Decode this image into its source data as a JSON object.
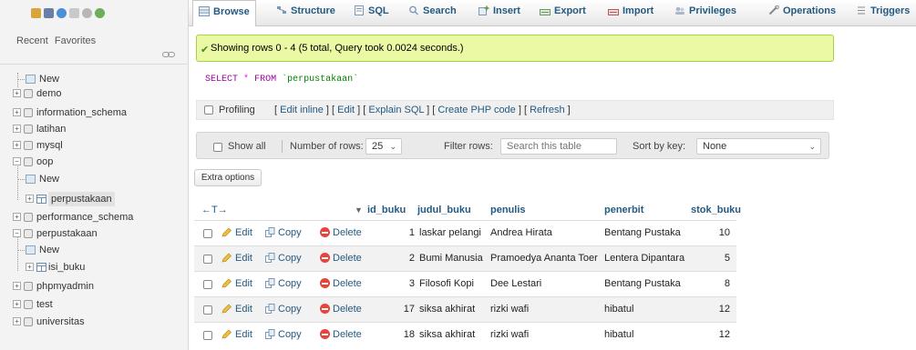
{
  "sidebar": {
    "tabs": [
      "Recent",
      "Favorites"
    ],
    "tree": [
      {
        "label": "New",
        "kind": "new"
      },
      {
        "label": "demo",
        "kind": "db"
      },
      {
        "label": "information_schema",
        "kind": "db"
      },
      {
        "label": "latihan",
        "kind": "db"
      },
      {
        "label": "mysql",
        "kind": "db"
      },
      {
        "label": "oop",
        "kind": "db-open"
      },
      {
        "label": "New",
        "kind": "new-child"
      },
      {
        "label": "perpustakaan",
        "kind": "table-selected"
      },
      {
        "label": "performance_schema",
        "kind": "db"
      },
      {
        "label": "perpustakaan",
        "kind": "db-open"
      },
      {
        "label": "New",
        "kind": "new-child"
      },
      {
        "label": "isi_buku",
        "kind": "table"
      },
      {
        "label": "phpmyadmin",
        "kind": "db"
      },
      {
        "label": "test",
        "kind": "db"
      },
      {
        "label": "universitas",
        "kind": "db"
      }
    ]
  },
  "tabs": [
    {
      "label": "Browse",
      "icon": "browse-icon",
      "active": true
    },
    {
      "label": "Structure",
      "icon": "structure-icon"
    },
    {
      "label": "SQL",
      "icon": "sql-icon"
    },
    {
      "label": "Search",
      "icon": "search-icon"
    },
    {
      "label": "Insert",
      "icon": "insert-icon"
    },
    {
      "label": "Export",
      "icon": "export-icon"
    },
    {
      "label": "Import",
      "icon": "import-icon"
    },
    {
      "label": "Privileges",
      "icon": "privileges-icon"
    },
    {
      "label": "Operations",
      "icon": "operations-icon"
    },
    {
      "label": "Triggers",
      "icon": "triggers-icon"
    }
  ],
  "success": {
    "message": "Showing rows 0 - 4 (5 total, Query took 0.0024 seconds.)"
  },
  "query": {
    "keyword1": "SELECT",
    "star": "*",
    "keyword2": "FROM",
    "table": "`perpustakaan`"
  },
  "profiling": {
    "label": "Profiling",
    "links": [
      "Edit inline",
      "Edit",
      "Explain SQL",
      "Create PHP code",
      "Refresh"
    ]
  },
  "nav": {
    "show_all": "Show all",
    "rows_label": "Number of rows:",
    "rows_value": "25",
    "filter_label": "Filter rows:",
    "filter_placeholder": "Search this table",
    "sort_label": "Sort by key:",
    "sort_value": "None"
  },
  "extra_options": "Extra options",
  "table": {
    "arrows": "←T→",
    "sort_marker": "▼",
    "columns": [
      "id_buku",
      "judul_buku",
      "penulis",
      "penerbit",
      "stok_buku"
    ],
    "actions": {
      "edit": "Edit",
      "copy": "Copy",
      "delete": "Delete"
    },
    "rows": [
      {
        "id_buku": "1",
        "judul_buku": "laskar pelangi",
        "penulis": "Andrea Hirata",
        "penerbit": "Bentang Pustaka",
        "stok_buku": "10"
      },
      {
        "id_buku": "2",
        "judul_buku": "Bumi Manusia",
        "penulis": "Pramoedya Ananta Toer",
        "penerbit": "Lentera Dipantara",
        "stok_buku": "5"
      },
      {
        "id_buku": "3",
        "judul_buku": "Filosofi Kopi",
        "penulis": "Dee Lestari",
        "penerbit": "Bentang Pustaka",
        "stok_buku": "8"
      },
      {
        "id_buku": "17",
        "judul_buku": "siksa akhirat",
        "penulis": "rizki wafi",
        "penerbit": "hibatul",
        "stok_buku": "12"
      },
      {
        "id_buku": "18",
        "judul_buku": "siksa akhirat",
        "penulis": "rizki wafi",
        "penerbit": "hibatul",
        "stok_buku": "12"
      }
    ]
  },
  "colors": {
    "link": "#235a81",
    "success_bg": "#ebf8a4",
    "success_border": "#a2d246",
    "delete": "#e8443a"
  }
}
